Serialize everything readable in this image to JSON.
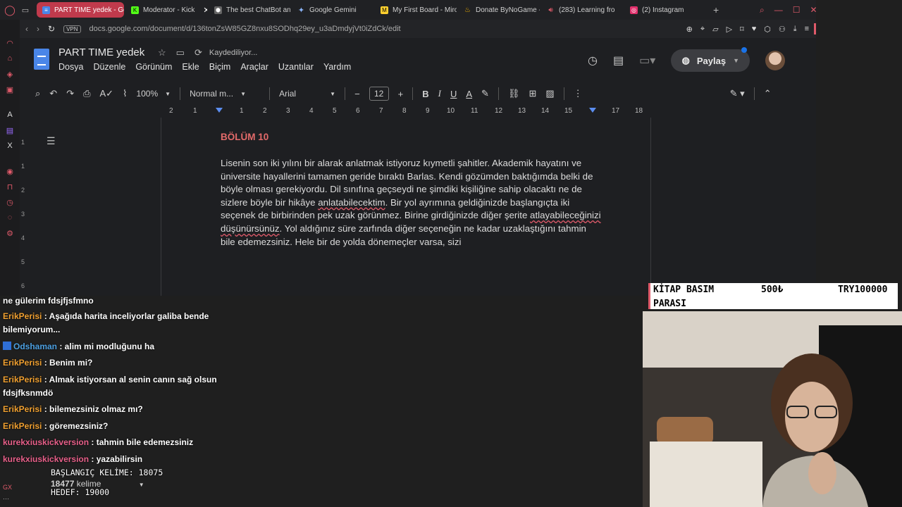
{
  "tabs": [
    {
      "label": "PART TIME yedek - Goog",
      "icon": "docs-icon",
      "color": "#4a86e8",
      "active": true
    },
    {
      "label": "Moderator - Kick",
      "icon": "kick-icon",
      "color": "#53fc18",
      "active": false
    },
    {
      "label": "The best ChatBot and",
      "icon": "chatbot-icon",
      "color": "#888888",
      "active": false
    },
    {
      "label": "Google Gemini",
      "icon": "gemini-icon",
      "color": "#8ab4f8",
      "active": false
    },
    {
      "label": "My First Board - Miro",
      "icon": "miro-icon",
      "color": "#ffd02f",
      "active": false
    },
    {
      "label": "Donate ByNoGame - Ç",
      "icon": "donate-icon",
      "color": "#f4b400",
      "active": false
    },
    {
      "label": "(283) Learning fro",
      "icon": "youtube-icon",
      "color": "#ff0000",
      "active": false
    },
    {
      "label": "(2) Instagram",
      "icon": "instagram-icon",
      "color": "#e1306c",
      "active": false
    }
  ],
  "address": {
    "vpn": "VPN",
    "url": "docs.google.com/document/d/136tonZsW85GZ8nxu8SODhq29ey_u3aDmdyjVt0iZdCk/edit"
  },
  "doc": {
    "title": "PART TIME  yedek",
    "saving": "Kaydediliyor...",
    "menus": [
      "Dosya",
      "Düzenle",
      "Görünüm",
      "Ekle",
      "Biçim",
      "Araçlar",
      "Uzantılar",
      "Yardım"
    ],
    "share_label": "Paylaş"
  },
  "toolbar": {
    "zoom": "100%",
    "style": "Normal m...",
    "font": "Arial",
    "size": "12"
  },
  "ruler": {
    "h_ticks": [
      "2",
      "1",
      "1",
      "2",
      "3",
      "4",
      "5",
      "6",
      "7",
      "8",
      "9",
      "10",
      "11",
      "12",
      "13",
      "14",
      "15",
      "16",
      "17",
      "18"
    ],
    "v_ticks": [
      "1",
      "1",
      "2",
      "3",
      "4",
      "5",
      "6",
      "7"
    ]
  },
  "page": {
    "chapter": "BÖLÜM 10",
    "p_a": "Lisenin son iki yılını bir alarak anlatmak istiyoruz kıymetli şahitler. Akademik hayatını ve üniversite hayallerini tamamen geride bıraktı Barlas. Kendi gözümden baktığımda belki de böyle olması gerekiyordu. Dil sınıfına geçseydi ne şimdiki kişiliğine sahip olacaktı ne de sizlere böyle bir hikâye ",
    "w_1": "anlatabilecektim",
    "p_b": ". Bir yol ayrımına geldiğinizde başlangıçta iki seçenek de birbirinden pek uzak görünmez. Birine girdiğinizde diğer şerite ",
    "w_2": "atlayabileceğinizi",
    "p_c": " ",
    "w_3": "düşünürsünüz",
    "p_d": ". Yol aldığınız süre zarfında diğer seçeneğin ne kadar uzaklaştığını tahmin bile edemezsiniz. Hele bir de yolda dönemeçler varsa, sizi"
  },
  "chat": {
    "partial": "ne gülerim fdsjfjsfmno",
    "messages": [
      {
        "user": "ErikPerisi",
        "color": "orange",
        "text": " : Aşağıda harita inceliyorlar galiba bende bilemiyorum..."
      },
      {
        "user": "Odshaman",
        "color": "blue",
        "text": " : alim mi modluğunu ha"
      },
      {
        "user": "ErikPerisi",
        "color": "orange",
        "text": " : Benim mi?"
      },
      {
        "user": "ErikPerisi",
        "color": "orange",
        "text": " : Almak istiyorsan al senin canın sağ olsun fdsjfksnmdö"
      },
      {
        "user": "ErikPerisi",
        "color": "orange",
        "text": " : bilemezsiniz olmaz mı?"
      },
      {
        "user": "ErikPerisi",
        "color": "orange",
        "text": " : göremezsiniz?"
      },
      {
        "user": "kurekxiuskickversion",
        "color": "pink",
        "text": " : tahmin bile edemezsiniz"
      },
      {
        "user": "kurekxiuskickversion",
        "color": "pink",
        "text": " : yazabilirsin"
      }
    ]
  },
  "counter": {
    "start": "BAŞLANGIÇ KELİME: 18075",
    "current": "18477",
    "current_unit": "kelime",
    "goal": "HEDEF: 19000"
  },
  "goal_box": {
    "label_line1": "KİTAP BASIM",
    "label_line2": "PARASI",
    "raised": "500₺",
    "target": "TRY100000"
  }
}
